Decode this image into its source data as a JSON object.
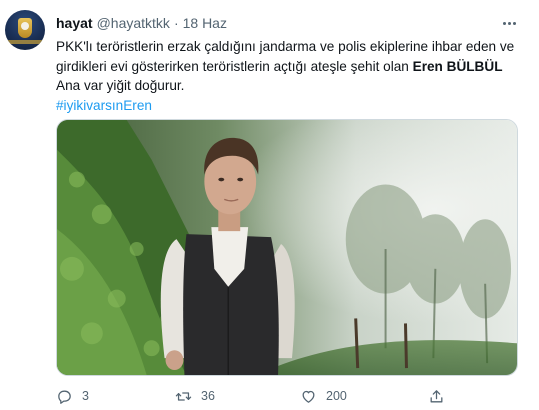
{
  "tweet": {
    "author_name": "hayat",
    "handle": "@hayatktkk",
    "separator": "·",
    "date": "18 Haz",
    "text_line1": "PKK'lı teröristlerin erzak çaldığını jandarma ve polis ekiplerine ihbar eden ve",
    "text_line2_prefix": "girdikleri evi gösterirken teröristlerin açtığı ateşle şehit olan ",
    "text_line2_bold": "Eren BÜLBÜL",
    "text_line3": "Ana var yiğit doğurur.",
    "hashtag": "#iyikivarsınEren"
  },
  "actions": {
    "reply_count": "3",
    "retweet_count": "36",
    "like_count": "200",
    "share_count": ""
  },
  "icons": {
    "more": "more-dots-icon",
    "reply": "reply-icon",
    "retweet": "retweet-icon",
    "like": "heart-icon",
    "share": "share-icon"
  },
  "colors": {
    "link": "#1d9bf0",
    "muted": "#536471",
    "text": "#0f1419"
  }
}
